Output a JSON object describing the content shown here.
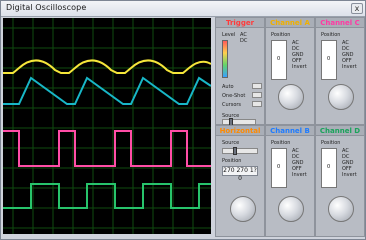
{
  "window": {
    "title": "Digital Oscilloscope",
    "close_label": "x"
  },
  "colors": {
    "trace_a": "#f5e63a",
    "trace_b": "#18b7c7",
    "trace_c": "#ff4da6",
    "trace_d": "#27c46b",
    "grid": "#0f4b0f"
  },
  "panels": {
    "trigger": {
      "title": "Trigger",
      "coupling_label": "Level",
      "options": [
        "AC",
        "DC"
      ],
      "mode_auto": "Auto",
      "mode_one_shot": "One-Shot",
      "cursors": "Cursors",
      "source": "Source"
    },
    "channel_a": {
      "title": "Channel A",
      "position_label": "Position",
      "position_value": "0",
      "options": [
        "AC",
        "DC",
        "GND",
        "OFF",
        "Invert"
      ]
    },
    "channel_b": {
      "title": "Channel B",
      "position_label": "Position",
      "position_value": "0",
      "options": [
        "AC",
        "DC",
        "GND",
        "OFF",
        "Invert"
      ]
    },
    "channel_c": {
      "title": "Channel C",
      "position_label": "Position",
      "position_value": "0",
      "options": [
        "AC",
        "DC",
        "GND",
        "OFF",
        "Invert"
      ]
    },
    "horizontal": {
      "title": "Horizontal",
      "source_label": "Source",
      "position_label": "Position",
      "display_value": "270 270 1?0"
    },
    "channel_d": {
      "title": "Channel D",
      "position_label": "Position",
      "position_value": "0",
      "options": [
        "AC",
        "DC",
        "GND",
        "OFF",
        "Invert"
      ]
    }
  }
}
